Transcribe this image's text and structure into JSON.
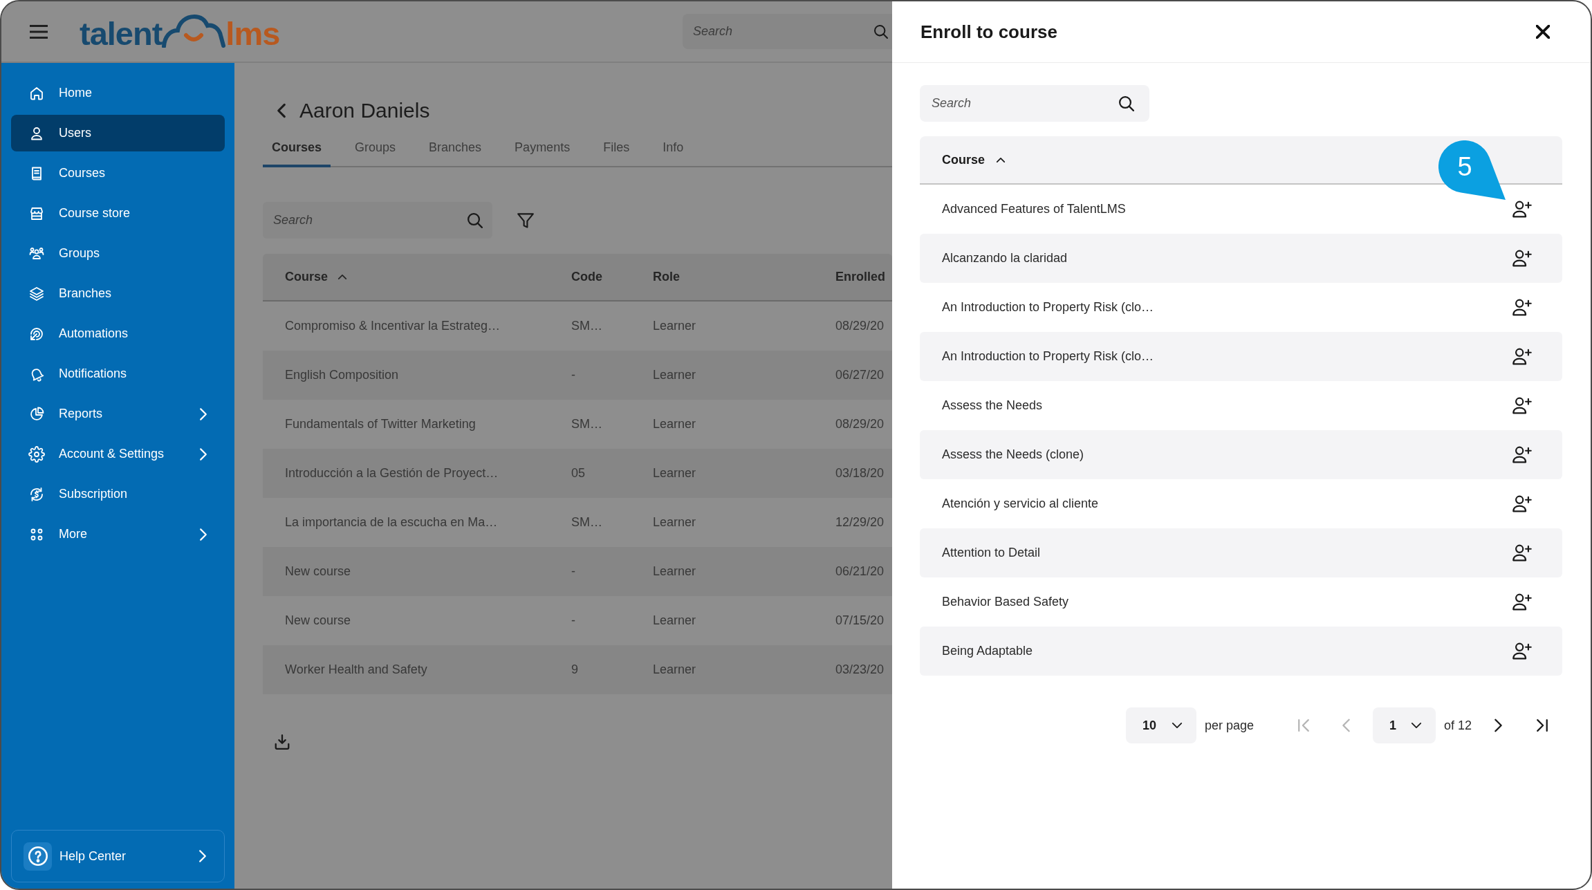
{
  "header": {
    "logo": [
      "talent",
      "lms"
    ],
    "search": {
      "placeholder": "Search"
    }
  },
  "sidebar": {
    "items": [
      {
        "label": "Home",
        "selected": false,
        "submenu": false
      },
      {
        "label": "Users",
        "selected": true,
        "submenu": false
      },
      {
        "label": "Courses",
        "selected": false,
        "submenu": false
      },
      {
        "label": "Course store",
        "selected": false,
        "submenu": false
      },
      {
        "label": "Groups",
        "selected": false,
        "submenu": false
      },
      {
        "label": "Branches",
        "selected": false,
        "submenu": false
      },
      {
        "label": "Automations",
        "selected": false,
        "submenu": false
      },
      {
        "label": "Notifications",
        "selected": false,
        "submenu": false
      },
      {
        "label": "Reports",
        "selected": false,
        "submenu": true
      },
      {
        "label": "Account & Settings",
        "selected": false,
        "submenu": true
      },
      {
        "label": "Subscription",
        "selected": false,
        "submenu": false
      },
      {
        "label": "More",
        "selected": false,
        "submenu": true
      }
    ],
    "help": {
      "label": "Help Center"
    }
  },
  "page": {
    "title": "Aaron Daniels",
    "tabs": [
      {
        "label": "Courses",
        "selected": true
      },
      {
        "label": "Groups",
        "selected": false
      },
      {
        "label": "Branches",
        "selected": false
      },
      {
        "label": "Payments",
        "selected": false
      },
      {
        "label": "Files",
        "selected": false
      },
      {
        "label": "Info",
        "selected": false
      }
    ],
    "search": {
      "placeholder": "Search"
    },
    "table": {
      "columns": [
        {
          "label": "Course",
          "sorted": true
        },
        {
          "label": "Code",
          "sorted": false
        },
        {
          "label": "Role",
          "sorted": false
        },
        {
          "label": "Enrolled",
          "sorted": false
        }
      ],
      "rows": [
        [
          "Compromiso & Incentivar la Estrateg…",
          "SM…",
          "Learner",
          "08/29/20"
        ],
        [
          "English Composition",
          "-",
          "Learner",
          "06/27/20"
        ],
        [
          "Fundamentals of Twitter Marketing",
          "SM…",
          "Learner",
          "08/29/20"
        ],
        [
          "Introducción a la Gestión de Proyect…",
          "05",
          "Learner",
          "03/18/20"
        ],
        [
          "La importancia de la escucha en Ma…",
          "SM…",
          "Learner",
          "12/29/20"
        ],
        [
          "New course",
          "-",
          "Learner",
          "06/21/20"
        ],
        [
          "New course",
          "-",
          "Learner",
          "07/15/20"
        ],
        [
          "Worker Health and Safety",
          "9",
          "Learner",
          "03/23/20"
        ]
      ]
    }
  },
  "panel": {
    "title": "Enroll to course",
    "search": {
      "placeholder": "Search"
    },
    "table": {
      "columns": [
        {
          "label": "Course",
          "sorted": true
        }
      ],
      "rows": [
        "Advanced Features of TalentLMS",
        "Alcanzando la claridad",
        "An Introduction to Property Risk (clo…",
        "An Introduction to Property Risk (clo…",
        "Assess the Needs",
        "Assess the Needs (clone)",
        "Atención y servicio al cliente",
        "Attention to Detail",
        "Behavior Based Safety",
        "Being Adaptable"
      ]
    },
    "pagination": {
      "per_page": "10",
      "per_page_label": "per page",
      "back": [
        {
          "kind": "first",
          "disabled": true
        },
        {
          "kind": "prev",
          "disabled": true
        }
      ],
      "page": "1",
      "total": "of 12",
      "forward": [
        {
          "kind": "next",
          "disabled": false
        },
        {
          "kind": "last",
          "disabled": false
        }
      ]
    },
    "callout": {
      "label": "5"
    }
  }
}
